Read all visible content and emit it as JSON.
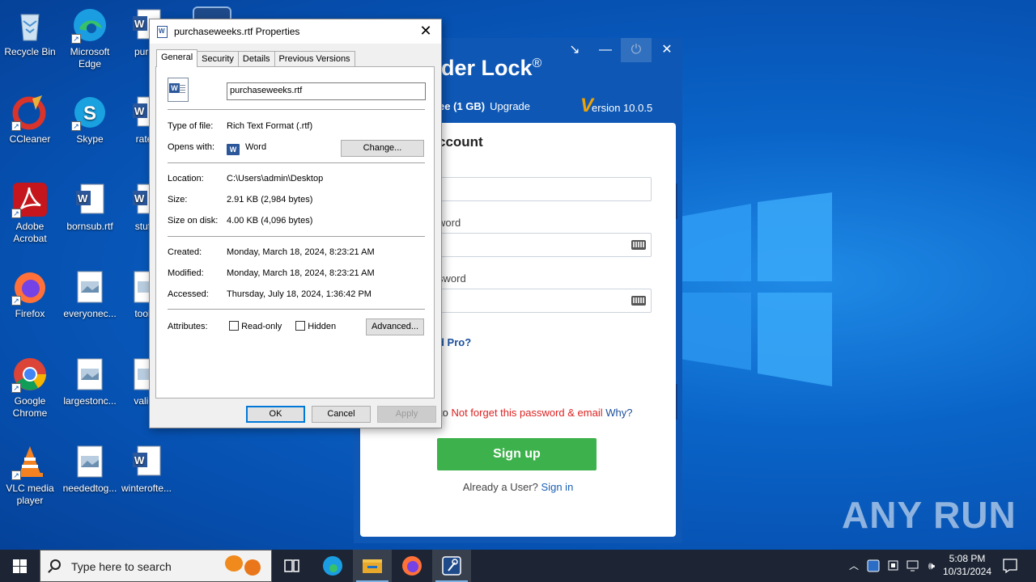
{
  "desktop": {
    "icons": [
      {
        "id": "recycle-bin",
        "label": "Recycle Bin"
      },
      {
        "id": "edge",
        "label": "Microsoft Edge"
      },
      {
        "id": "purch",
        "label": "purch"
      },
      {
        "id": "ccleaner",
        "label": "CCleaner"
      },
      {
        "id": "skype",
        "label": "Skype"
      },
      {
        "id": "rated",
        "label": "ratec"
      },
      {
        "id": "acrobat",
        "label": "Adobe Acrobat"
      },
      {
        "id": "bornsub",
        "label": "bornsub.rtf"
      },
      {
        "id": "stuffs",
        "label": "stuffs"
      },
      {
        "id": "firefox",
        "label": "Firefox"
      },
      {
        "id": "everyone",
        "label": "everyonec..."
      },
      {
        "id": "tookh",
        "label": "tookh"
      },
      {
        "id": "chrome",
        "label": "Google Chrome"
      },
      {
        "id": "largestonc",
        "label": "largestonc..."
      },
      {
        "id": "validp",
        "label": "validp"
      },
      {
        "id": "vlc",
        "label": "VLC media player"
      },
      {
        "id": "neededtog",
        "label": "neededtog..."
      },
      {
        "id": "winterofte",
        "label": "winterofte..."
      }
    ],
    "watermark": "ANY RUN"
  },
  "folder_lock": {
    "title": "der Lock",
    "title_mark": "®",
    "free": "ree (1 GB)",
    "upgrade": "Upgrade",
    "version_v": "V",
    "version": "ersion 10.0.5",
    "heading": "ccount",
    "password_label": "word",
    "confirm_label": "sword",
    "pro_link": "d Pro?",
    "note_prefix": "to",
    "note_red": "Not forget this password & email",
    "note_why": "Why?",
    "signup": "Sign up",
    "already": "Already a User?",
    "signin": "Sign in"
  },
  "properties": {
    "title": "purchaseweeks.rtf Properties",
    "tabs": [
      "General",
      "Security",
      "Details",
      "Previous Versions"
    ],
    "file_name": "purchaseweeks.rtf",
    "type_label": "Type of file:",
    "type_value": "Rich Text Format (.rtf)",
    "opens_label": "Opens with:",
    "opens_value": "Word",
    "change_btn": "Change...",
    "location_label": "Location:",
    "location_value": "C:\\Users\\admin\\Desktop",
    "size_label": "Size:",
    "size_value": "2.91 KB (2,984 bytes)",
    "disk_label": "Size on disk:",
    "disk_value": "4.00 KB (4,096 bytes)",
    "created_label": "Created:",
    "created_value": "Monday, March 18, 2024, 8:23:21 AM",
    "modified_label": "Modified:",
    "modified_value": "Monday, March 18, 2024, 8:23:21 AM",
    "accessed_label": "Accessed:",
    "accessed_value": "Thursday, July 18, 2024, 1:36:42 PM",
    "attributes_label": "Attributes:",
    "readonly": "Read-only",
    "hidden": "Hidden",
    "advanced_btn": "Advanced...",
    "ok": "OK",
    "cancel": "Cancel",
    "apply": "Apply"
  },
  "taskbar": {
    "search_placeholder": "Type here to search",
    "time": "5:08 PM",
    "date": "10/31/2024"
  },
  "colors": {
    "accent": "#0078d7",
    "signup_green": "#3db14b",
    "folderlock_blue": "#0e57b4",
    "taskbar": "#1d2535"
  }
}
